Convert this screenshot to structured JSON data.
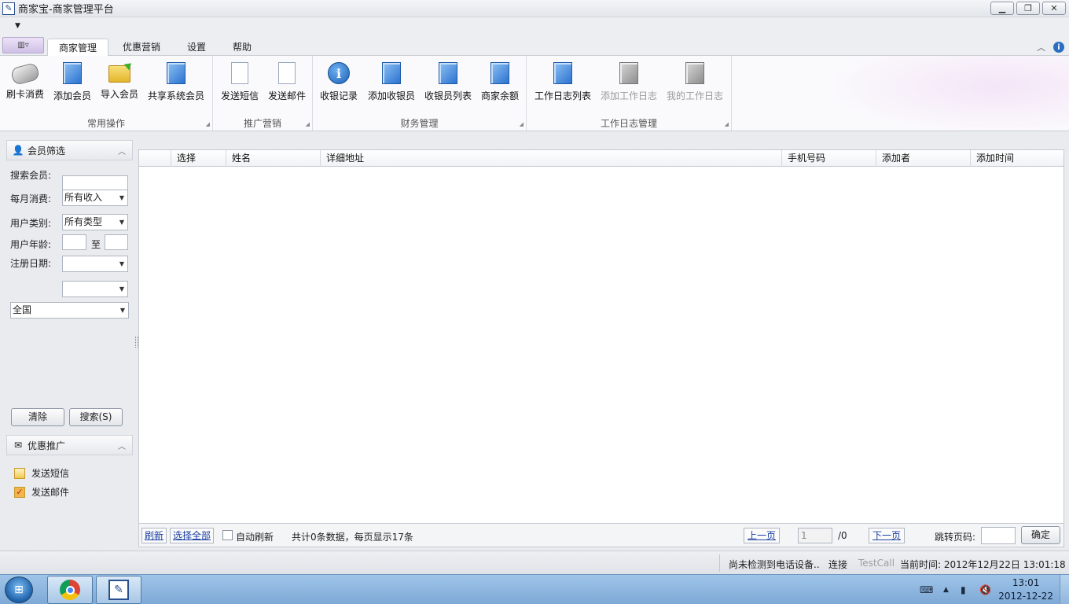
{
  "window": {
    "title": "商家宝-商家管理平台",
    "min_label": "▁",
    "max_label": "❐",
    "close_label": "✕"
  },
  "tabs": [
    {
      "label": "商家管理",
      "active": true
    },
    {
      "label": "优惠营销",
      "active": false
    },
    {
      "label": "设置",
      "active": false
    },
    {
      "label": "帮助",
      "active": false
    }
  ],
  "ribbon": {
    "groups": [
      {
        "label": "常用操作",
        "buttons": [
          "刷卡消费",
          "添加会员",
          "导入会员",
          "共享系统会员"
        ]
      },
      {
        "label": "推广营销",
        "buttons": [
          "发送短信",
          "发送邮件"
        ]
      },
      {
        "label": "财务管理",
        "buttons": [
          "收银记录",
          "添加收银员",
          "收银员列表",
          "商家余额"
        ]
      },
      {
        "label": "工作日志管理",
        "buttons": [
          "工作日志列表",
          "添加工作日志",
          "我的工作日志"
        ]
      }
    ]
  },
  "filter_panel": {
    "title": "会员筛选",
    "search_label": "搜索会员:",
    "search_value": "",
    "monthly_label": "每月消费:",
    "monthly_value": "所有收入",
    "type_label": "用户类别:",
    "type_value": "所有类型",
    "age_label": "用户年龄:",
    "age_to": "至",
    "age_from_value": "",
    "age_to_value": "",
    "date_label": "注册日期:",
    "date_value": "",
    "date2_value": "",
    "region_value": "全国",
    "clear_label": "清除",
    "search_btn_label": "搜索(S)"
  },
  "promo_panel": {
    "title": "优惠推广",
    "items": [
      "发送短信",
      "发送邮件"
    ]
  },
  "grid": {
    "columns": [
      "选择",
      "姓名",
      "详细地址",
      "手机号码",
      "添加者",
      "添加时间"
    ],
    "rows": []
  },
  "pager": {
    "refresh": "刷新",
    "select_all": "选择全部",
    "auto_refresh": "自动刷新",
    "summary": "共计0条数据，每页显示17条",
    "prev": "上一页",
    "page_value": "1",
    "page_total": "/0",
    "next": "下一页",
    "jump_label": "跳转页码:",
    "jump_value": "",
    "confirm": "确定"
  },
  "status": {
    "device": "尚未检测到电话设备..",
    "connect": "连接",
    "testcall": "TestCall",
    "time": "当前时间: 2012年12月22日 13:01:18"
  },
  "taskbar": {
    "clock_time": "13:01",
    "clock_date": "2012-12-22"
  },
  "colors": {
    "accent": "#2b72cf",
    "link": "#1a3fa0",
    "disabled_text": "#9a9a9a"
  }
}
